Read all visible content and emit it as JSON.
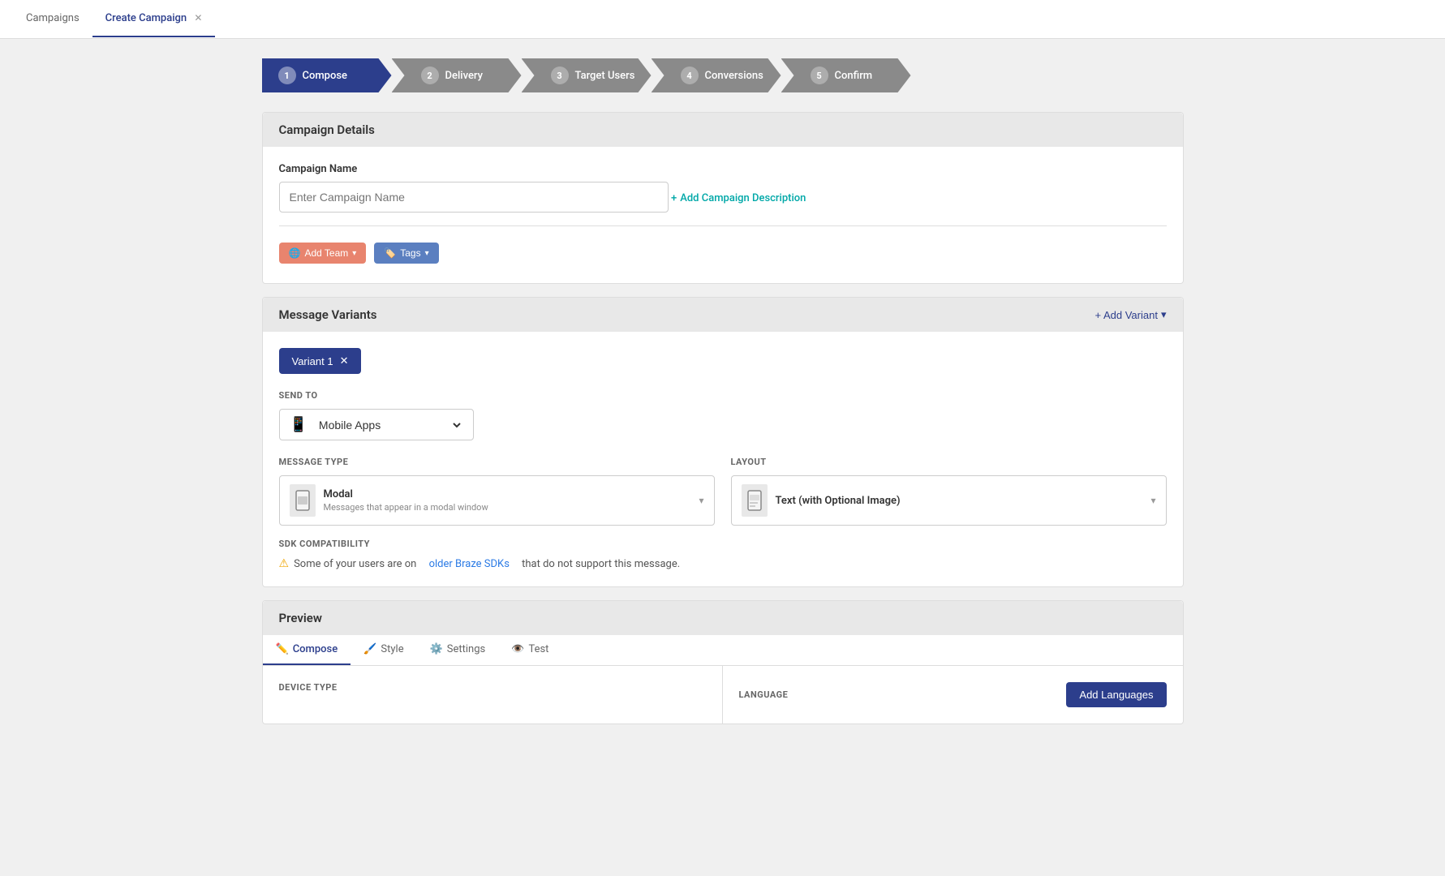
{
  "nav": {
    "tabs": [
      {
        "id": "campaigns",
        "label": "Campaigns",
        "active": false
      },
      {
        "id": "create-campaign",
        "label": "Create Campaign",
        "active": true,
        "closeable": true
      }
    ]
  },
  "steps": [
    {
      "num": "1",
      "label": "Compose",
      "active": true
    },
    {
      "num": "2",
      "label": "Delivery",
      "active": false
    },
    {
      "num": "3",
      "label": "Target Users",
      "active": false
    },
    {
      "num": "4",
      "label": "Conversions",
      "active": false
    },
    {
      "num": "5",
      "label": "Confirm",
      "active": false
    }
  ],
  "campaign_details": {
    "header": "Campaign Details",
    "campaign_name_label": "Campaign Name",
    "campaign_name_placeholder": "Enter Campaign Name",
    "add_description_label": "Add Campaign Description",
    "add_team_label": "Add Team",
    "tags_label": "Tags"
  },
  "message_variants": {
    "header": "Message Variants",
    "add_variant_label": "+ Add Variant",
    "variant_tab_label": "Variant 1",
    "send_to_label": "SEND TO",
    "send_to_option": "Mobile Apps",
    "message_type_label": "MESSAGE TYPE",
    "message_type_value": "Modal",
    "message_type_description": "Messages that appear in a modal window",
    "layout_label": "LAYOUT",
    "layout_value": "Text (with Optional Image)",
    "sdk_label": "SDK COMPATIBILITY",
    "sdk_warning": "Some of your users are on",
    "sdk_link": "older Braze SDKs",
    "sdk_warning_end": "that do not support this message."
  },
  "preview": {
    "header": "Preview",
    "tabs": [
      {
        "id": "compose",
        "label": "Compose",
        "icon": "✏️",
        "active": true
      },
      {
        "id": "style",
        "label": "Style",
        "icon": "🖌️",
        "active": false
      },
      {
        "id": "settings",
        "label": "Settings",
        "icon": "⚙️",
        "active": false
      },
      {
        "id": "test",
        "label": "Test",
        "icon": "👁️",
        "active": false
      }
    ],
    "device_type_label": "DEVICE TYPE",
    "language_label": "LANGUAGE",
    "add_languages_label": "Add Languages"
  },
  "colors": {
    "primary": "#2c3e8c",
    "teal": "#00a8a8",
    "salmon": "#e8846e",
    "blue_tag": "#5b7fc0",
    "step_inactive": "#8a8a8a"
  }
}
